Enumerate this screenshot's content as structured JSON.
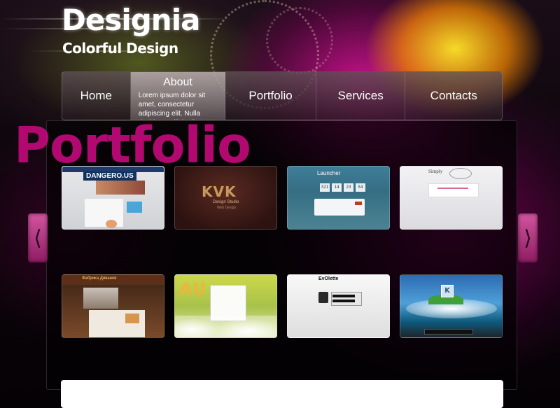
{
  "header": {
    "site_title": "Designia",
    "tagline": "Colorful Design"
  },
  "nav": {
    "items": [
      {
        "label": "Home"
      },
      {
        "label": "About",
        "description": "Lorem ipsum dolor sit amet, consectetur adipiscing elit. Nulla tincidunt sollicitudin",
        "active": true
      },
      {
        "label": "Portfolio"
      },
      {
        "label": "Services"
      },
      {
        "label": "Contacts"
      }
    ]
  },
  "portfolio": {
    "heading": "Portfolio",
    "prev_arrow": "⟨",
    "next_arrow": "⟩",
    "thumbnails": [
      {
        "caption": "DANGERO.US"
      },
      {
        "caption": "KVK",
        "subcaption": "Design Studio",
        "subcaption2": "Web Design"
      },
      {
        "caption": "Launcher",
        "counters": [
          "321",
          "14",
          "23",
          "54"
        ]
      },
      {
        "caption": "Simply"
      },
      {
        "caption": "Фабрика Диванов"
      },
      {
        "caption": "AU"
      },
      {
        "caption": "EvOlette"
      },
      {
        "caption": "K"
      }
    ]
  },
  "colors": {
    "accent": "#c00a7a",
    "arrow": "#b83a88",
    "nav_text": "#ffffff"
  }
}
